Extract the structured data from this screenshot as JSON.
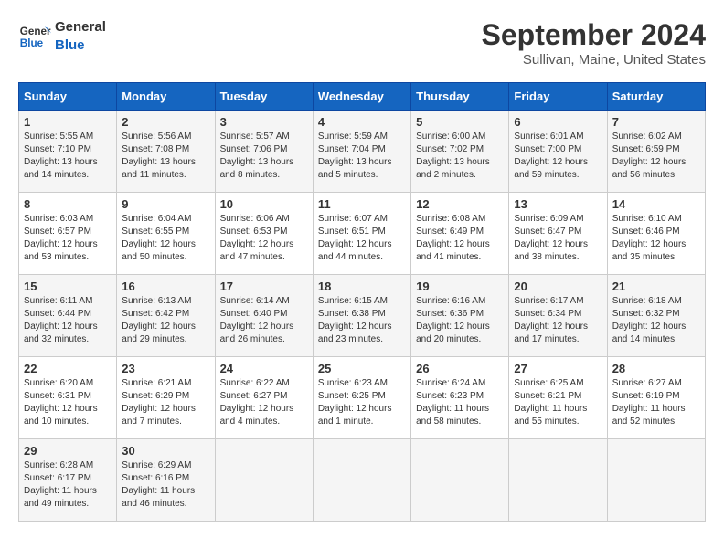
{
  "header": {
    "logo_line1": "General",
    "logo_line2": "Blue",
    "month": "September 2024",
    "location": "Sullivan, Maine, United States"
  },
  "weekdays": [
    "Sunday",
    "Monday",
    "Tuesday",
    "Wednesday",
    "Thursday",
    "Friday",
    "Saturday"
  ],
  "weeks": [
    [
      {
        "day": "1",
        "info": "Sunrise: 5:55 AM\nSunset: 7:10 PM\nDaylight: 13 hours\nand 14 minutes."
      },
      {
        "day": "2",
        "info": "Sunrise: 5:56 AM\nSunset: 7:08 PM\nDaylight: 13 hours\nand 11 minutes."
      },
      {
        "day": "3",
        "info": "Sunrise: 5:57 AM\nSunset: 7:06 PM\nDaylight: 13 hours\nand 8 minutes."
      },
      {
        "day": "4",
        "info": "Sunrise: 5:59 AM\nSunset: 7:04 PM\nDaylight: 13 hours\nand 5 minutes."
      },
      {
        "day": "5",
        "info": "Sunrise: 6:00 AM\nSunset: 7:02 PM\nDaylight: 13 hours\nand 2 minutes."
      },
      {
        "day": "6",
        "info": "Sunrise: 6:01 AM\nSunset: 7:00 PM\nDaylight: 12 hours\nand 59 minutes."
      },
      {
        "day": "7",
        "info": "Sunrise: 6:02 AM\nSunset: 6:59 PM\nDaylight: 12 hours\nand 56 minutes."
      }
    ],
    [
      {
        "day": "8",
        "info": "Sunrise: 6:03 AM\nSunset: 6:57 PM\nDaylight: 12 hours\nand 53 minutes."
      },
      {
        "day": "9",
        "info": "Sunrise: 6:04 AM\nSunset: 6:55 PM\nDaylight: 12 hours\nand 50 minutes."
      },
      {
        "day": "10",
        "info": "Sunrise: 6:06 AM\nSunset: 6:53 PM\nDaylight: 12 hours\nand 47 minutes."
      },
      {
        "day": "11",
        "info": "Sunrise: 6:07 AM\nSunset: 6:51 PM\nDaylight: 12 hours\nand 44 minutes."
      },
      {
        "day": "12",
        "info": "Sunrise: 6:08 AM\nSunset: 6:49 PM\nDaylight: 12 hours\nand 41 minutes."
      },
      {
        "day": "13",
        "info": "Sunrise: 6:09 AM\nSunset: 6:47 PM\nDaylight: 12 hours\nand 38 minutes."
      },
      {
        "day": "14",
        "info": "Sunrise: 6:10 AM\nSunset: 6:46 PM\nDaylight: 12 hours\nand 35 minutes."
      }
    ],
    [
      {
        "day": "15",
        "info": "Sunrise: 6:11 AM\nSunset: 6:44 PM\nDaylight: 12 hours\nand 32 minutes."
      },
      {
        "day": "16",
        "info": "Sunrise: 6:13 AM\nSunset: 6:42 PM\nDaylight: 12 hours\nand 29 minutes."
      },
      {
        "day": "17",
        "info": "Sunrise: 6:14 AM\nSunset: 6:40 PM\nDaylight: 12 hours\nand 26 minutes."
      },
      {
        "day": "18",
        "info": "Sunrise: 6:15 AM\nSunset: 6:38 PM\nDaylight: 12 hours\nand 23 minutes."
      },
      {
        "day": "19",
        "info": "Sunrise: 6:16 AM\nSunset: 6:36 PM\nDaylight: 12 hours\nand 20 minutes."
      },
      {
        "day": "20",
        "info": "Sunrise: 6:17 AM\nSunset: 6:34 PM\nDaylight: 12 hours\nand 17 minutes."
      },
      {
        "day": "21",
        "info": "Sunrise: 6:18 AM\nSunset: 6:32 PM\nDaylight: 12 hours\nand 14 minutes."
      }
    ],
    [
      {
        "day": "22",
        "info": "Sunrise: 6:20 AM\nSunset: 6:31 PM\nDaylight: 12 hours\nand 10 minutes."
      },
      {
        "day": "23",
        "info": "Sunrise: 6:21 AM\nSunset: 6:29 PM\nDaylight: 12 hours\nand 7 minutes."
      },
      {
        "day": "24",
        "info": "Sunrise: 6:22 AM\nSunset: 6:27 PM\nDaylight: 12 hours\nand 4 minutes."
      },
      {
        "day": "25",
        "info": "Sunrise: 6:23 AM\nSunset: 6:25 PM\nDaylight: 12 hours\nand 1 minute."
      },
      {
        "day": "26",
        "info": "Sunrise: 6:24 AM\nSunset: 6:23 PM\nDaylight: 11 hours\nand 58 minutes."
      },
      {
        "day": "27",
        "info": "Sunrise: 6:25 AM\nSunset: 6:21 PM\nDaylight: 11 hours\nand 55 minutes."
      },
      {
        "day": "28",
        "info": "Sunrise: 6:27 AM\nSunset: 6:19 PM\nDaylight: 11 hours\nand 52 minutes."
      }
    ],
    [
      {
        "day": "29",
        "info": "Sunrise: 6:28 AM\nSunset: 6:17 PM\nDaylight: 11 hours\nand 49 minutes."
      },
      {
        "day": "30",
        "info": "Sunrise: 6:29 AM\nSunset: 6:16 PM\nDaylight: 11 hours\nand 46 minutes."
      },
      {
        "day": "",
        "info": ""
      },
      {
        "day": "",
        "info": ""
      },
      {
        "day": "",
        "info": ""
      },
      {
        "day": "",
        "info": ""
      },
      {
        "day": "",
        "info": ""
      }
    ]
  ]
}
